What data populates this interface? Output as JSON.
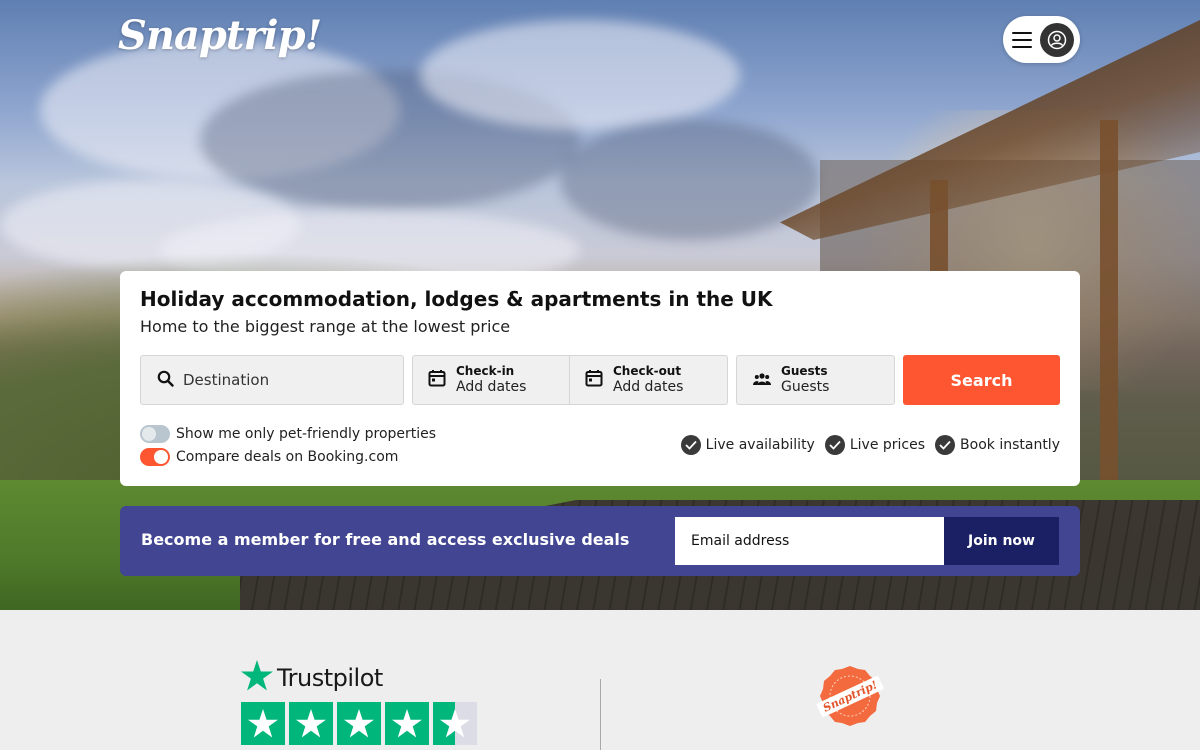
{
  "header": {
    "logo_text": "Snaptrip!",
    "menu_icon": "hamburger-menu-icon",
    "account_icon": "user-circle-icon"
  },
  "search_card": {
    "title": "Holiday accommodation, lodges & apartments in the UK",
    "subtitle": "Home to the biggest range at the lowest price",
    "destination": {
      "placeholder": "Destination",
      "icon": "search-icon"
    },
    "checkin": {
      "label": "Check-in",
      "value": "Add dates",
      "icon": "calendar-icon"
    },
    "checkout": {
      "label": "Check-out",
      "value": "Add dates",
      "icon": "calendar-icon"
    },
    "guests": {
      "label": "Guests",
      "value": "Guests",
      "icon": "users-icon"
    },
    "search_button": "Search",
    "toggles": [
      {
        "label": "Show me only pet-friendly properties",
        "on": false
      },
      {
        "label": "Compare deals on Booking.com",
        "on": true
      }
    ],
    "features": [
      "Live availability",
      "Live prices",
      "Book instantly"
    ]
  },
  "member_banner": {
    "text": "Become a member for free and access exclusive deals",
    "email_placeholder": "Email address",
    "join_button": "Join now"
  },
  "trust": {
    "trustpilot_name": "Trustpilot",
    "stars": 4.5,
    "badge_text": "Snaptrip!"
  },
  "colors": {
    "accent": "#fd5631",
    "banner": "#414592",
    "join": "#1b1f64",
    "trustpilot": "#00b67a"
  }
}
